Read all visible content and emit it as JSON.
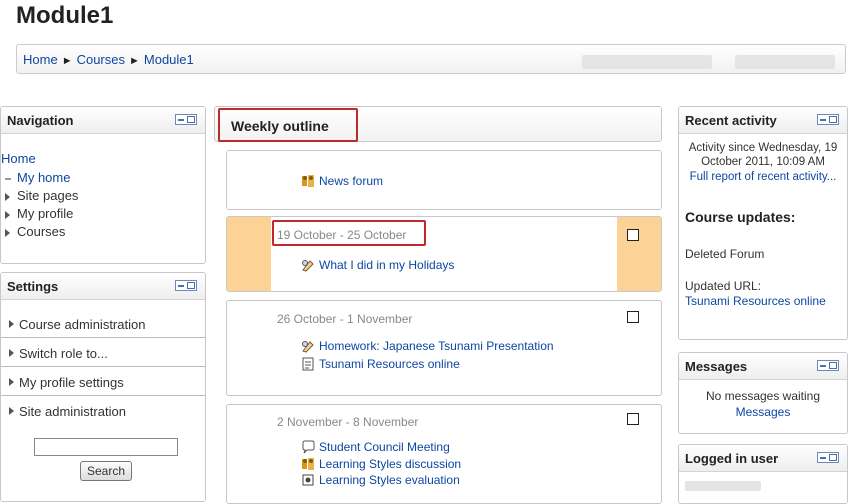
{
  "page": {
    "title": "Module1"
  },
  "breadcrumb": {
    "items": [
      "Home",
      "Courses",
      "Module1"
    ]
  },
  "navigation": {
    "title": "Navigation",
    "home": "Home",
    "items": [
      {
        "label": "My home",
        "marker": "dot"
      },
      {
        "label": "Site pages",
        "marker": "triangle"
      },
      {
        "label": "My profile",
        "marker": "triangle"
      },
      {
        "label": "Courses",
        "marker": "triangle"
      }
    ]
  },
  "settings": {
    "title": "Settings",
    "items": [
      "Course administration",
      "Switch role to...",
      "My profile settings",
      "Site administration"
    ],
    "search_button": "Search",
    "search_value": ""
  },
  "outline": {
    "title": "Weekly outline",
    "news_forum": "News forum",
    "sections": [
      {
        "date": "19 October - 25 October",
        "current": true,
        "activities": [
          "What I did in my Holidays"
        ]
      },
      {
        "date": "26 October - 1 November",
        "current": false,
        "activities": [
          "Homework: Japanese Tsunami Presentation",
          "Tsunami Resources online"
        ]
      },
      {
        "date": "2 November - 8 November",
        "current": false,
        "activities": [
          "Student Council Meeting",
          "Learning Styles discussion",
          "Learning Styles evaluation"
        ]
      }
    ]
  },
  "recent_activity": {
    "title": "Recent activity",
    "since_line1": "Activity since Wednesday, 19",
    "since_line2": "October 2011, 10:09 AM",
    "full_report": "Full report of recent activity...",
    "updates_heading": "Course updates:",
    "deleted": "Deleted Forum",
    "updated_url_label": "Updated URL:",
    "updated_url_link": "Tsunami Resources online"
  },
  "messages": {
    "title": "Messages",
    "none": "No messages waiting",
    "link": "Messages"
  },
  "logged_in": {
    "title": "Logged in user"
  },
  "colors": {
    "link": "#0d47a1",
    "highlight": "#fcd395",
    "annotation_red": "#c0282d"
  }
}
